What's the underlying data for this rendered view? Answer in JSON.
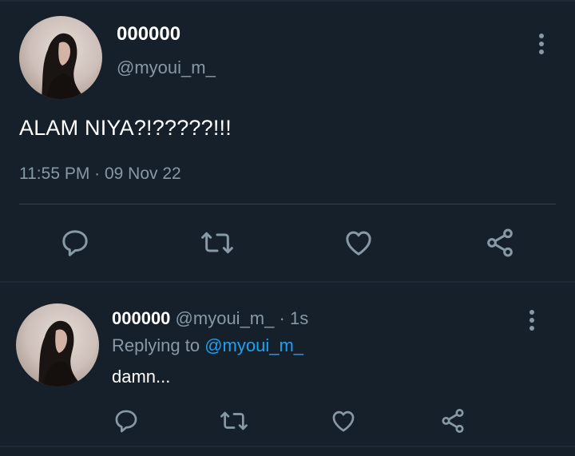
{
  "colors": {
    "background": "#15202b",
    "secondary_text": "#8899a6",
    "accent_link": "#1da1f2",
    "divider": "#38444d"
  },
  "main_tweet": {
    "display_name": "000000",
    "handle": "@myoui_m_",
    "text": "ALAM NIYA?!?????!!!",
    "timestamp": "11:55 PM · 09 Nov 22",
    "icons": {
      "more": "more-vertical-icon",
      "reply": "reply-icon",
      "retweet": "retweet-icon",
      "like": "heart-icon",
      "share": "share-icon"
    }
  },
  "reply_tweet": {
    "display_name": "000000",
    "handle": "@myoui_m_",
    "separator": "·",
    "time": "1s",
    "replying_label": "Replying to",
    "replying_to": "@myoui_m_",
    "text": "damn..."
  }
}
